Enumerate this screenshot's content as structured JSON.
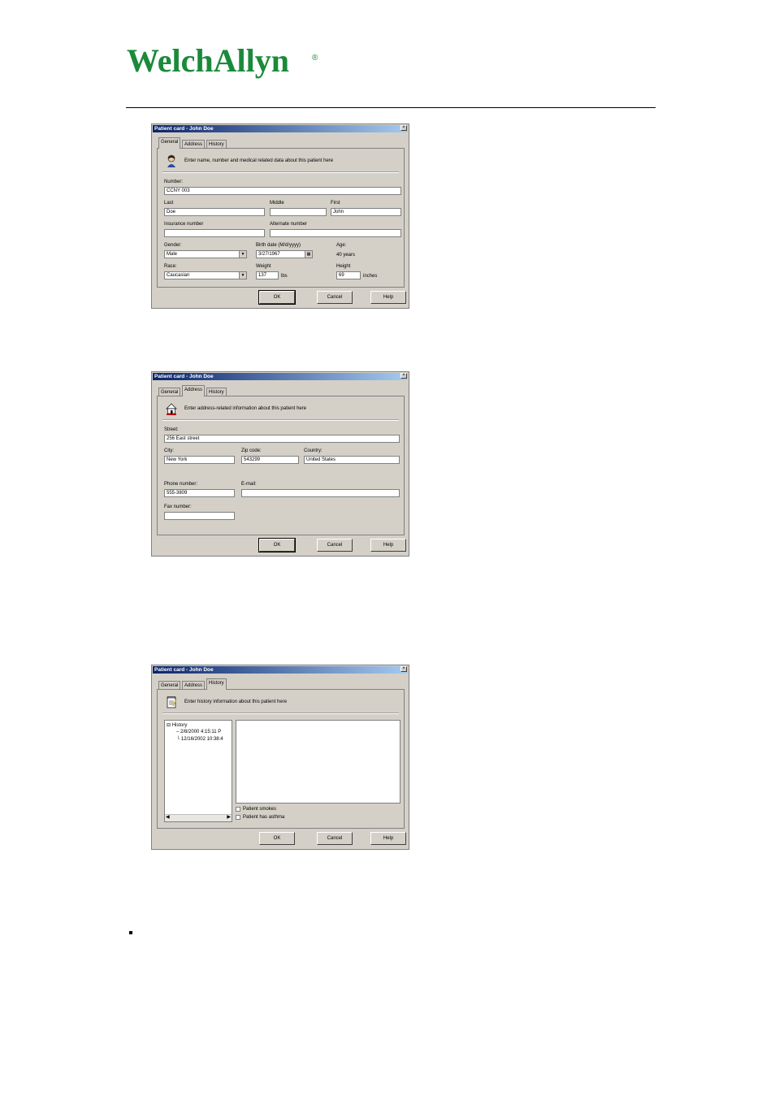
{
  "logo": {
    "text": "WelchAllyn",
    "mark": "®",
    "color": "#1a8a3a"
  },
  "dialogs": [
    {
      "title": "Patient card - John Doe",
      "tabs": [
        "General",
        "Address",
        "History"
      ],
      "active_tab": "General",
      "hint": "Enter name, number and medical related data about this patient here",
      "fields": {
        "number_label": "Number:",
        "number": "CCNY 003",
        "last_label": "Last",
        "last": "Doe",
        "middle_label": "Middle",
        "middle": "",
        "first_label": "First",
        "first": "John",
        "insurance_label": "Insurance number",
        "insurance": "",
        "alternate_label": "Alternate number",
        "alternate": "",
        "gender_label": "Gender:",
        "gender": "Male",
        "birth_label": "Birth date   (M/d/yyyy)",
        "birth": "3/27/1967",
        "age_label": "Age:",
        "age": "40 years",
        "race_label": "Race:",
        "race": "Caucasian",
        "weight_label": "Weight",
        "weight": "137",
        "weight_unit": "lbs",
        "height_label": "Height",
        "height": "69",
        "height_unit": "inches"
      },
      "buttons": {
        "ok": "OK",
        "cancel": "Cancel",
        "help": "Help"
      }
    },
    {
      "title": "Patient card - John Doe",
      "tabs": [
        "General",
        "Address",
        "History"
      ],
      "active_tab": "Address",
      "hint": "Enter address-related information about this patient here",
      "fields": {
        "street_label": "Street:",
        "street": "256 East street",
        "city_label": "City:",
        "city": "New York",
        "zip_label": "Zip code:",
        "zip": "543299",
        "country_label": "Country:",
        "country": "United States",
        "phone_label": "Phone number:",
        "phone": "555-3809",
        "email_label": "E-mail:",
        "email": "",
        "fax_label": "Fax number:",
        "fax": ""
      },
      "buttons": {
        "ok": "OK",
        "cancel": "Cancel",
        "help": "Help"
      }
    },
    {
      "title": "Patient card - John Doe",
      "tabs": [
        "General",
        "Address",
        "History"
      ],
      "active_tab": "History",
      "hint": "Enter history information about this patient here",
      "tree": {
        "root": "History",
        "items": [
          "2/8/2000 4:15:11 P",
          "12/16/2002 10:38:4"
        ]
      },
      "checkboxes": [
        "Patient smokes",
        "Patient has asthma"
      ],
      "buttons": {
        "ok": "OK",
        "cancel": "Cancel",
        "help": "Help"
      }
    }
  ]
}
